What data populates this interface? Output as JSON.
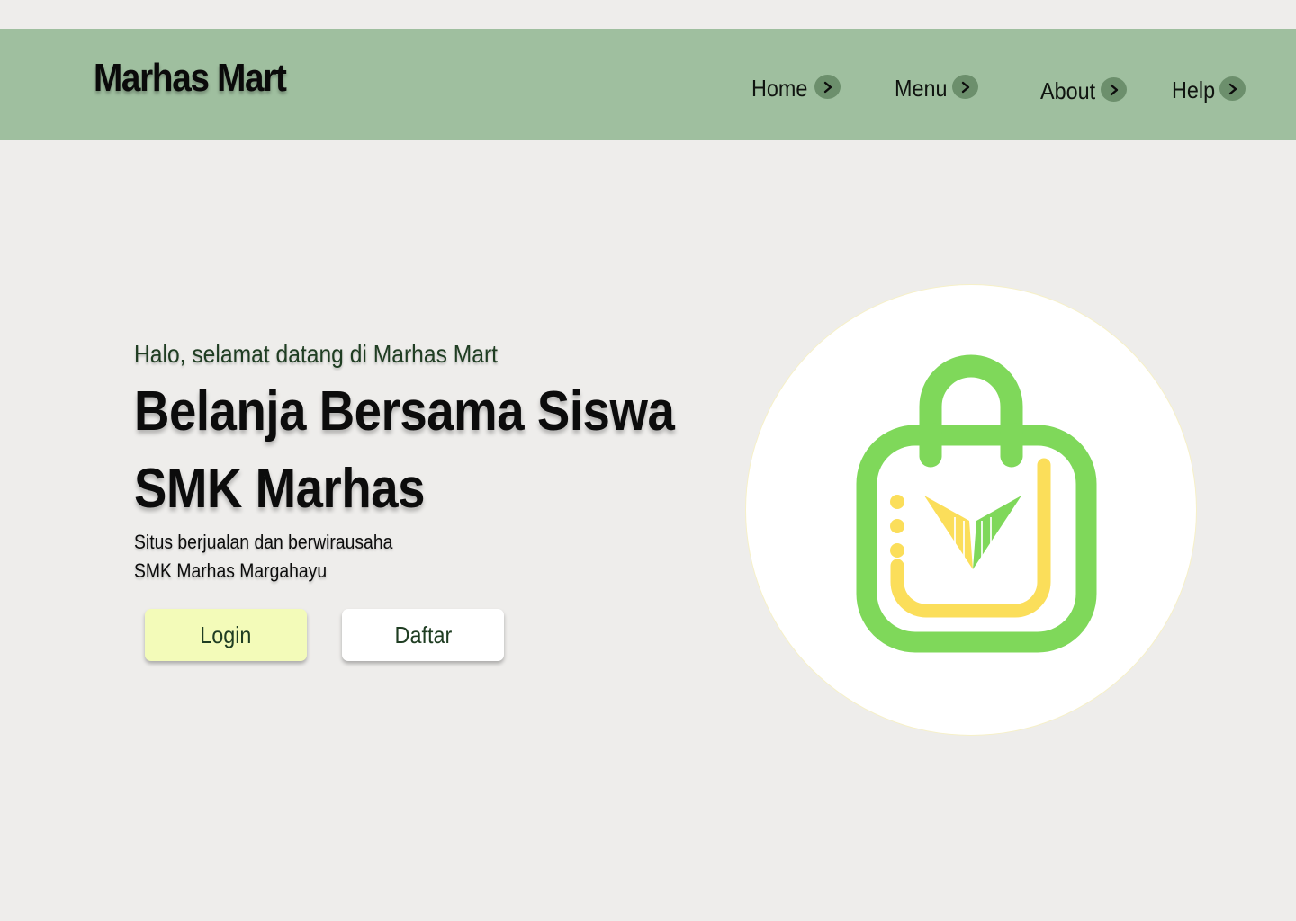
{
  "navbar": {
    "brand": "Marhas Mart",
    "background_color": "#9fbf9f",
    "items": [
      {
        "label": "Home",
        "icon": "chevron-right-icon"
      },
      {
        "label": "Menu",
        "icon": "chevron-right-icon"
      },
      {
        "label": "About",
        "icon": "chevron-right-icon"
      },
      {
        "label": "Help",
        "icon": "chevron-right-icon"
      }
    ]
  },
  "hero": {
    "greeting": "Halo, selamat datang di Marhas Mart",
    "headline_line1": "Belanja Bersama Siswa",
    "headline_line2": "SMK Marhas",
    "description_line1": "Situs berjualan dan berwirausaha",
    "description_line2": "SMK Marhas Margahayu"
  },
  "buttons": {
    "login_label": "Login",
    "login_color": "#f3fbb9",
    "daftar_label": "Daftar",
    "daftar_color": "#ffffff"
  },
  "logo": {
    "icon": "shopping-bag-logo-icon",
    "bag_color": "#7fd85a",
    "accent_color": "#fbde5a"
  },
  "colors": {
    "page_background": "#eeedeb",
    "text_dark_green": "#1f3d22"
  }
}
